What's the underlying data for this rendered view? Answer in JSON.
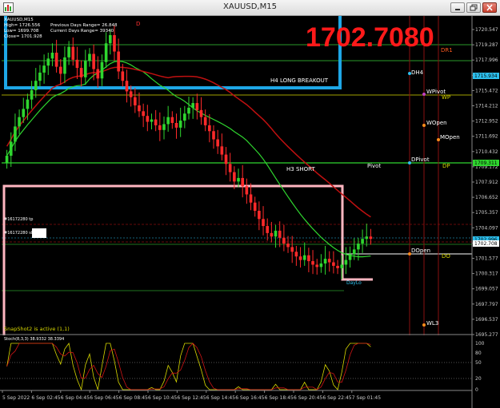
{
  "window": {
    "title": "XAUUSD,M15"
  },
  "info": {
    "symbol": "XAUUSD,M15",
    "high": "High= 1726.556",
    "low": "Low= 1699.708",
    "close": "Close= 1701.928",
    "prev_range": "Previous Days Range= 26.848",
    "cur_range": "Current Days Range= 39340"
  },
  "big_price": "1702.7080",
  "labels": {
    "h4_long": "H4 LONG BREAKOUT",
    "h3_short": "H3 SHORT",
    "tp": "#16172280 tp",
    "sl": "#16172280 sl",
    "snapshot": "SnapShot2 is active (1,1)",
    "dayhi": "D",
    "daylo": "DayLo"
  },
  "pivots": [
    {
      "name": "DR1",
      "color": "#ff5a1e"
    },
    {
      "name": "DH4",
      "color": "#ffffff"
    },
    {
      "name": "WPivot",
      "color": "#ffffff"
    },
    {
      "name": "WP",
      "color": "#d8d800"
    },
    {
      "name": "WOpen",
      "color": "#ffffff"
    },
    {
      "name": "MOpen",
      "color": "#ffffff"
    },
    {
      "name": "DPivot",
      "color": "#ffffff"
    },
    {
      "name": "DP",
      "color": "#d8d800"
    },
    {
      "name": "Pivot",
      "color": "#ffffff"
    },
    {
      "name": "DOpen",
      "color": "#ffffff"
    },
    {
      "name": "DO",
      "color": "#d8d800"
    },
    {
      "name": "WL3",
      "color": "#ffffff"
    }
  ],
  "price_axis": {
    "ticks": [
      "1720.547",
      "1719.287",
      "1717.996",
      "1716.735",
      "1715.472",
      "1714.212",
      "1712.952",
      "1711.692",
      "1710.432",
      "1709.172",
      "1707.912",
      "1706.652",
      "1705.357",
      "1704.097",
      "1702.837",
      "1701.577",
      "1700.317",
      "1699.057",
      "1697.797",
      "1696.537",
      "1695.277"
    ],
    "markers": [
      {
        "value": "1715.934",
        "color": "#2dc0ee"
      },
      {
        "value": "1709.311",
        "color": "#2fd62f"
      },
      {
        "value": "1702.996",
        "color": "#2dc0ee"
      },
      {
        "value": "1702.708",
        "color": "#ffffff"
      }
    ]
  },
  "stoch": {
    "label": "Stoch(8,3,3) 38.9332 38.3394",
    "axis": [
      "100",
      "80",
      "50",
      "20",
      "0"
    ]
  },
  "time_axis": [
    "5 Sep 2022",
    "6 Sep 02:45",
    "6 Sep 04:45",
    "6 Sep 06:45",
    "6 Sep 08:45",
    "6 Sep 10:45",
    "6 Sep 12:45",
    "6 Sep 14:45",
    "6 Sep 16:45",
    "6 Sep 18:45",
    "6 Sep 20:45",
    "6 Sep 22:45",
    "7 Sep 01:45"
  ],
  "colors": {
    "bull": "#2fd62f",
    "bear": "#ff2a2a",
    "h4_box": "#1ea7e6",
    "h3_box": "#ffb6c1",
    "big_price": "#ff1a1a"
  },
  "chart_data": {
    "type": "candlestick",
    "title": "XAUUSD,M15",
    "ylim": [
      1694.6,
      1721.6
    ],
    "x_categories": [
      "5 Sep 2022",
      "6 Sep 02:45",
      "6 Sep 04:45",
      "6 Sep 06:45",
      "6 Sep 08:45",
      "6 Sep 10:45",
      "6 Sep 12:45",
      "6 Sep 14:45",
      "6 Sep 16:45",
      "6 Sep 18:45",
      "6 Sep 20:45",
      "6 Sep 22:45",
      "7 Sep 01:45"
    ],
    "close_series": [
      1709.8,
      1711.0,
      1712.3,
      1713.1,
      1713.8,
      1714.6,
      1715.4,
      1716.2,
      1716.9,
      1717.5,
      1718.1,
      1718.6,
      1717.4,
      1716.8,
      1718.2,
      1719.1,
      1718.0,
      1717.3,
      1716.5,
      1717.9,
      1718.5,
      1717.2,
      1716.4,
      1717.8,
      1719.4,
      1720.1,
      1718.7,
      1717.0,
      1716.2,
      1715.3,
      1714.8,
      1714.1,
      1713.6,
      1713.2,
      1712.7,
      1712.9,
      1712.4,
      1712.0,
      1712.5,
      1713.1,
      1712.6,
      1712.2,
      1712.8,
      1713.4,
      1713.9,
      1714.3,
      1713.7,
      1713.1,
      1712.4,
      1711.9,
      1711.2,
      1710.6,
      1709.9,
      1709.1,
      1708.4,
      1707.6,
      1707.9,
      1707.2,
      1706.5,
      1705.8,
      1705.1,
      1704.4,
      1703.8,
      1703.2,
      1702.9,
      1703.4,
      1702.8,
      1702.3,
      1702.0,
      1701.6,
      1701.2,
      1700.9,
      1701.3,
      1700.8,
      1700.5,
      1700.3,
      1700.6,
      1701.0,
      1700.7,
      1700.4,
      1700.2,
      1700.5,
      1700.9,
      1701.4,
      1701.8,
      1702.3,
      1702.7,
      1702.9,
      1702.7
    ]
  }
}
